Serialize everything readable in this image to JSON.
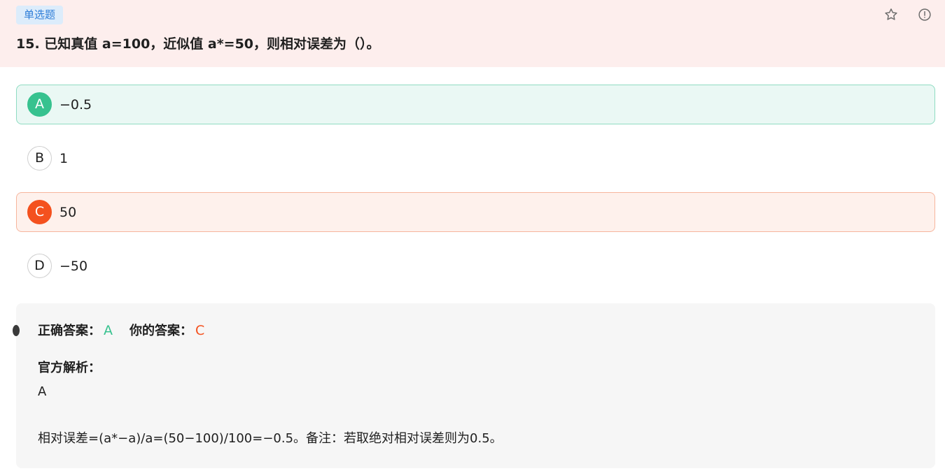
{
  "question": {
    "type_tag": "单选题",
    "title": "15. 已知真值 a=100，近似值 a*=50，则相对误差为（）。",
    "favorite_icon": "star-outline-icon",
    "report_icon": "alert-circle-icon"
  },
  "options": [
    {
      "letter": "A",
      "text": "−0.5",
      "state": "correct"
    },
    {
      "letter": "B",
      "text": "1",
      "state": "normal"
    },
    {
      "letter": "C",
      "text": "50",
      "state": "selected-wrong"
    },
    {
      "letter": "D",
      "text": "−50",
      "state": "normal"
    }
  ],
  "result": {
    "correct_label": "正确答案：",
    "correct_value": "A",
    "yours_label": "你的答案：",
    "yours_value": "C"
  },
  "explanation": {
    "label": "官方解析：",
    "answer": "A",
    "detail": "相对误差=(a*−a)/a=(50−100)/100=−0.5。备注：若取绝对相对误差则为0.5。"
  },
  "colors": {
    "correct": "#37c28f",
    "wrong": "#f4511e",
    "tag": "#2f7ed8",
    "header_bg": "#fdeeed"
  }
}
